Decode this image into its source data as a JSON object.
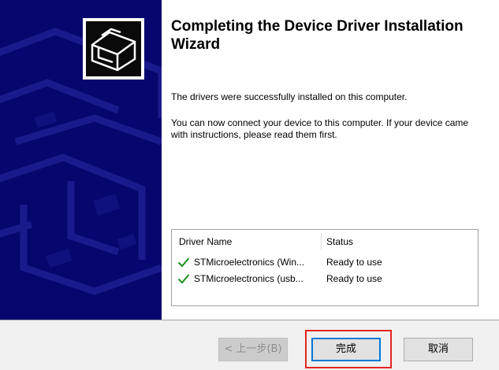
{
  "wizard": {
    "title": "Completing the Device Driver Installation Wizard",
    "message_success": "The drivers were successfully installed on this computer.",
    "message_connect": "You can now connect your device to this computer. If your device came with instructions, please read them first."
  },
  "driver_list": {
    "columns": [
      "Driver Name",
      "Status"
    ],
    "rows": [
      {
        "name": "STMicroelectronics (Win...",
        "status": "Ready to use",
        "icon": "checkmark-icon"
      },
      {
        "name": "STMicroelectronics (usb...",
        "status": "Ready to use",
        "icon": "checkmark-icon"
      }
    ]
  },
  "buttons": {
    "back": "< 上一步(B)",
    "finish": "完成",
    "cancel": "取消"
  },
  "colors": {
    "banner": "#06066e",
    "check": "#1a8f1a",
    "highlight": "#e0261f",
    "focus": "#0078d7"
  }
}
